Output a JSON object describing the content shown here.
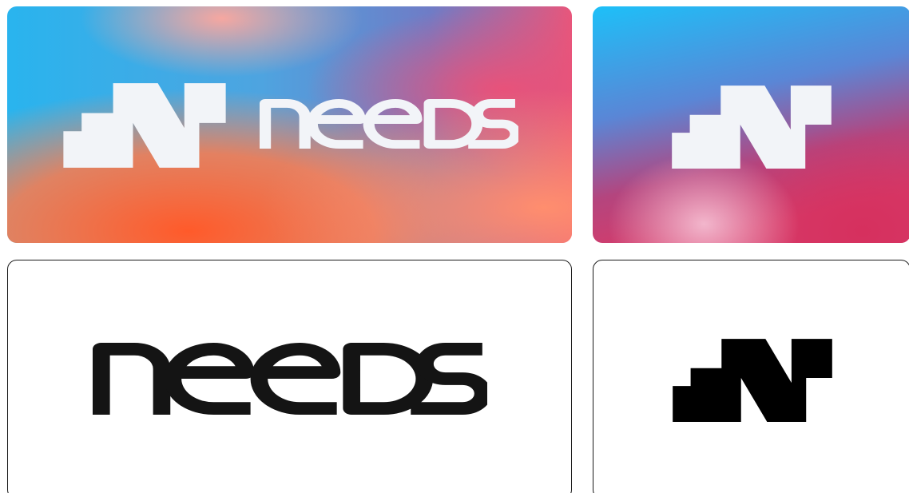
{
  "brand": {
    "name": "NEEDS",
    "wordmark_text": "needs"
  },
  "cards": [
    {
      "variant": "gradient-logo-with-wordmark",
      "mark_color": "#f2f4f8"
    },
    {
      "variant": "gradient-logo-mark-only",
      "mark_color": "#f2f4f8"
    },
    {
      "variant": "outlined-wordmark-only",
      "mark_color": "#111111"
    },
    {
      "variant": "outlined-logo-mark-only",
      "mark_color": "#000000"
    }
  ],
  "colors": {
    "gradient_cyan": "#22b8f0",
    "gradient_blue": "#4a90e2",
    "gradient_pink": "#e0547a",
    "gradient_orange": "#ff6a3d",
    "gradient_magenta": "#d63b6a",
    "outline": "#1a1a1a"
  }
}
